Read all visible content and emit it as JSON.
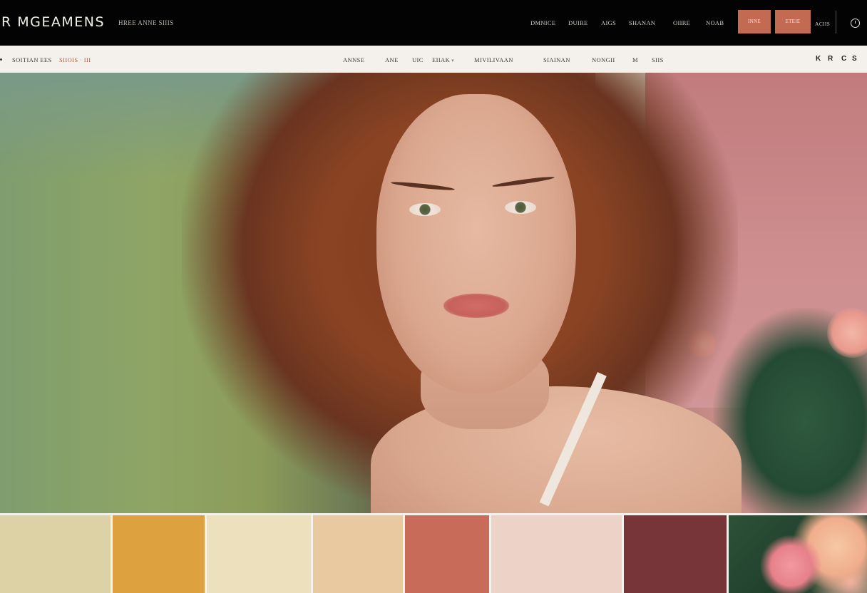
{
  "header": {
    "logo": "R MGEAMENS",
    "tagline": "HREE ANNE SIIIS",
    "nav": [
      "DMNICE",
      "DUIRE",
      "AIGS",
      "SHANAN",
      "OIIRE",
      "NOAB"
    ],
    "button_1": "INNE",
    "button_2": "ETEIE",
    "account": "ACIIS",
    "clock_icon": "clock-icon"
  },
  "subnav": {
    "left_label": "SOITIAN EES",
    "left_accent": "SIIOIS · III",
    "items": [
      "ANNSE",
      "ANE",
      "UIC",
      "EIIAK",
      "MIVILIVAAN",
      "SIAINAN",
      "NONGII",
      "M",
      "SIIS"
    ],
    "dropdown_item_index": 3,
    "tools": [
      "K",
      "R",
      "C",
      "S"
    ]
  },
  "hero": {
    "alt": "portrait"
  },
  "palette": {
    "swatches": [
      {
        "color": "#ddd2a6"
      },
      {
        "color": "#dea13f"
      },
      {
        "color": "#ede0bc"
      },
      {
        "color": "#e8c9a0"
      },
      {
        "color": "#c86b58"
      },
      {
        "color": "#edd2c7"
      },
      {
        "color": "#77353a"
      },
      {
        "color": "floral-photo"
      }
    ]
  }
}
